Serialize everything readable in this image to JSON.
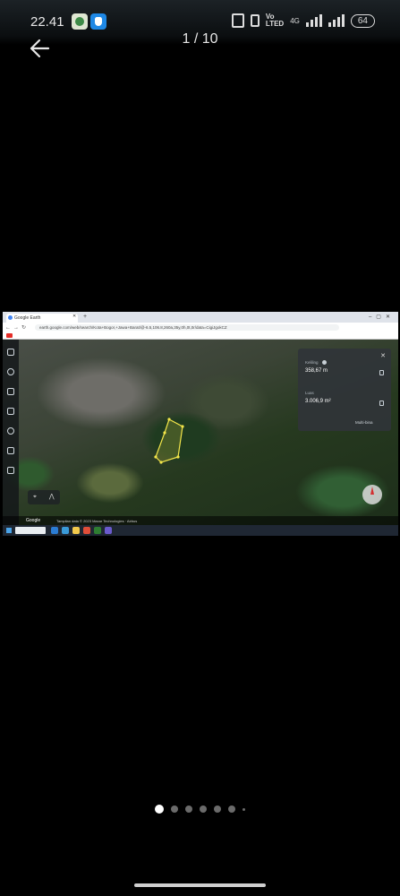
{
  "status_bar": {
    "time": "22.41",
    "lte_label": "Vo\nLTED",
    "network_label": "4G",
    "battery": "64"
  },
  "viewer": {
    "counter": "1 / 10",
    "total_dots": 7,
    "active_dot": 0
  },
  "screenshot": {
    "tab_title": "Google Earth",
    "url": "earth.google.com/web/search/Kota+Bogor,+Jawa+Barat/@-6.5,106.8,260a,35y,0h,0t,0r/data=CigiJgokCZ",
    "measure": {
      "perimeter_label": "Keliling",
      "perimeter_value": "358,67 m",
      "area_label": "Luas",
      "area_value": "3.006,9 m²",
      "multi_label": "Multi-bina"
    },
    "footer": {
      "brand": "Google",
      "text": "Tampilan data © 2023 Maxar Technologies · Airbus"
    }
  },
  "colors": {
    "accent": "#ffffff",
    "measure_outline": "#f4e64a"
  }
}
